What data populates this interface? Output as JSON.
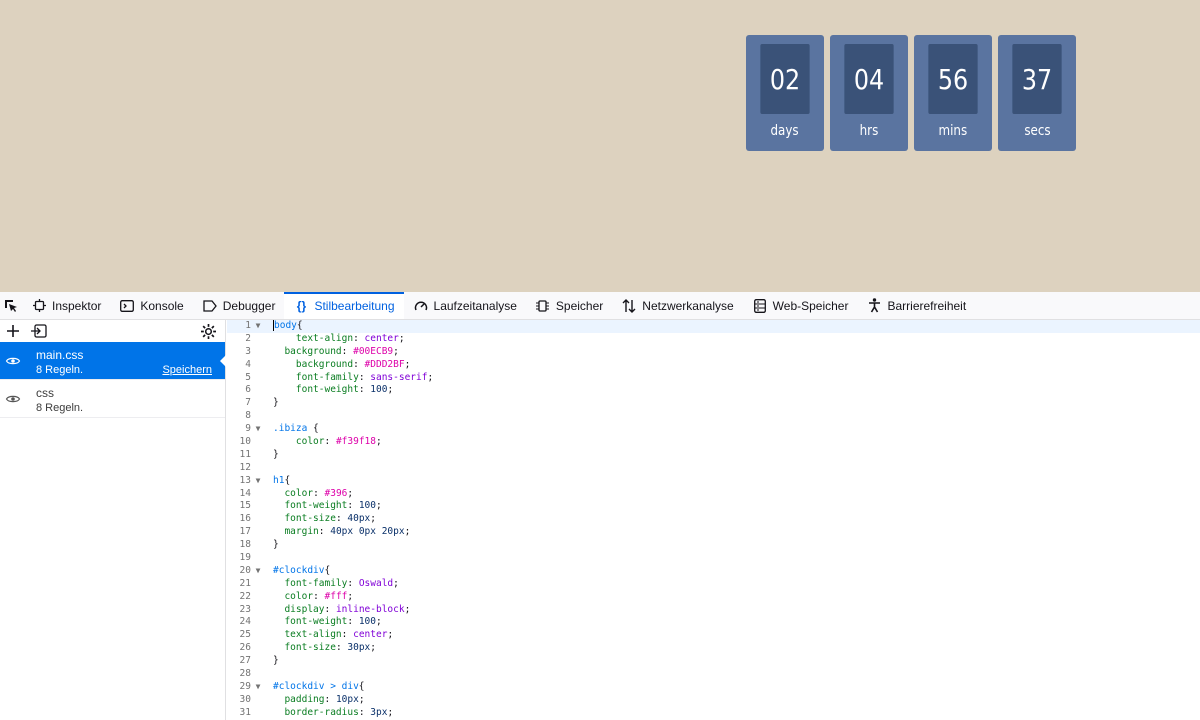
{
  "clock": {
    "units": [
      {
        "value": "02",
        "label": "days"
      },
      {
        "value": "04",
        "label": "hrs"
      },
      {
        "value": "56",
        "label": "mins"
      },
      {
        "value": "37",
        "label": "secs"
      }
    ]
  },
  "devtools": {
    "tabs": [
      {
        "label": "Inspektor",
        "icon": "inspector-icon"
      },
      {
        "label": "Konsole",
        "icon": "console-icon"
      },
      {
        "label": "Debugger",
        "icon": "debugger-icon"
      },
      {
        "label": "Stilbearbeitung",
        "icon": "style-editor-icon",
        "active": true
      },
      {
        "label": "Laufzeitanalyse",
        "icon": "performance-icon"
      },
      {
        "label": "Speicher",
        "icon": "memory-icon"
      },
      {
        "label": "Netzwerkanalyse",
        "icon": "network-icon"
      },
      {
        "label": "Web-Speicher",
        "icon": "storage-icon"
      },
      {
        "label": "Barrierefreiheit",
        "icon": "accessibility-icon"
      }
    ],
    "sheets": [
      {
        "name": "main.css",
        "rules": "8 Regeln.",
        "save_label": "Speichern",
        "selected": true
      },
      {
        "name": "css",
        "rules": "8 Regeln.",
        "selected": false
      }
    ],
    "code_lines": [
      {
        "n": "1",
        "fold": true,
        "html": "<span class='caret'></span><span class='sel'>body</span>{"
      },
      {
        "n": "2",
        "html": "    <span class='prop'>text-align</span>: <span class='val'>center</span>;"
      },
      {
        "n": "3",
        "html": "  <span class='prop'>background</span>: <span class='col'>#00ECB9</span>;"
      },
      {
        "n": "4",
        "html": "    <span class='prop'>background</span>: <span class='col'>#DDD2BF</span>;"
      },
      {
        "n": "5",
        "html": "    <span class='prop'>font-family</span>: <span class='val'>sans-serif</span>;"
      },
      {
        "n": "6",
        "html": "    <span class='prop'>font-weight</span>: <span class='num'>100</span>;"
      },
      {
        "n": "7",
        "html": "}"
      },
      {
        "n": "8",
        "html": ""
      },
      {
        "n": "9",
        "fold": true,
        "html": "<span class='sel'>.ibiza</span> {"
      },
      {
        "n": "10",
        "html": "    <span class='prop'>color</span>: <span class='col'>#f39f18</span>;"
      },
      {
        "n": "11",
        "html": "}"
      },
      {
        "n": "12",
        "html": ""
      },
      {
        "n": "13",
        "fold": true,
        "html": "<span class='sel'>h1</span>{"
      },
      {
        "n": "14",
        "html": "  <span class='prop'>color</span>: <span class='col'>#396</span>;"
      },
      {
        "n": "15",
        "html": "  <span class='prop'>font-weight</span>: <span class='num'>100</span>;"
      },
      {
        "n": "16",
        "html": "  <span class='prop'>font-size</span>: <span class='num'>40px</span>;"
      },
      {
        "n": "17",
        "html": "  <span class='prop'>margin</span>: <span class='num'>40px 0px 20px</span>;"
      },
      {
        "n": "18",
        "html": "}"
      },
      {
        "n": "19",
        "html": ""
      },
      {
        "n": "20",
        "fold": true,
        "html": "<span class='sel'>#clockdiv</span>{"
      },
      {
        "n": "21",
        "html": "  <span class='prop'>font-family</span>: <span class='val'>Oswald</span>;"
      },
      {
        "n": "22",
        "html": "  <span class='prop'>color</span>: <span class='col'>#fff</span>;"
      },
      {
        "n": "23",
        "html": "  <span class='prop'>display</span>: <span class='val'>inline-block</span>;"
      },
      {
        "n": "24",
        "html": "  <span class='prop'>font-weight</span>: <span class='num'>100</span>;"
      },
      {
        "n": "25",
        "html": "  <span class='prop'>text-align</span>: <span class='val'>center</span>;"
      },
      {
        "n": "26",
        "html": "  <span class='prop'>font-size</span>: <span class='num'>30px</span>;"
      },
      {
        "n": "27",
        "html": "}"
      },
      {
        "n": "28",
        "html": ""
      },
      {
        "n": "29",
        "fold": true,
        "html": "<span class='sel'>#clockdiv &gt; div</span>{"
      },
      {
        "n": "30",
        "html": "  <span class='prop'>padding</span>: <span class='num'>10px</span>;"
      },
      {
        "n": "31",
        "html": "  <span class='prop'>border-radius</span>: <span class='num'>3px</span>;"
      }
    ]
  }
}
